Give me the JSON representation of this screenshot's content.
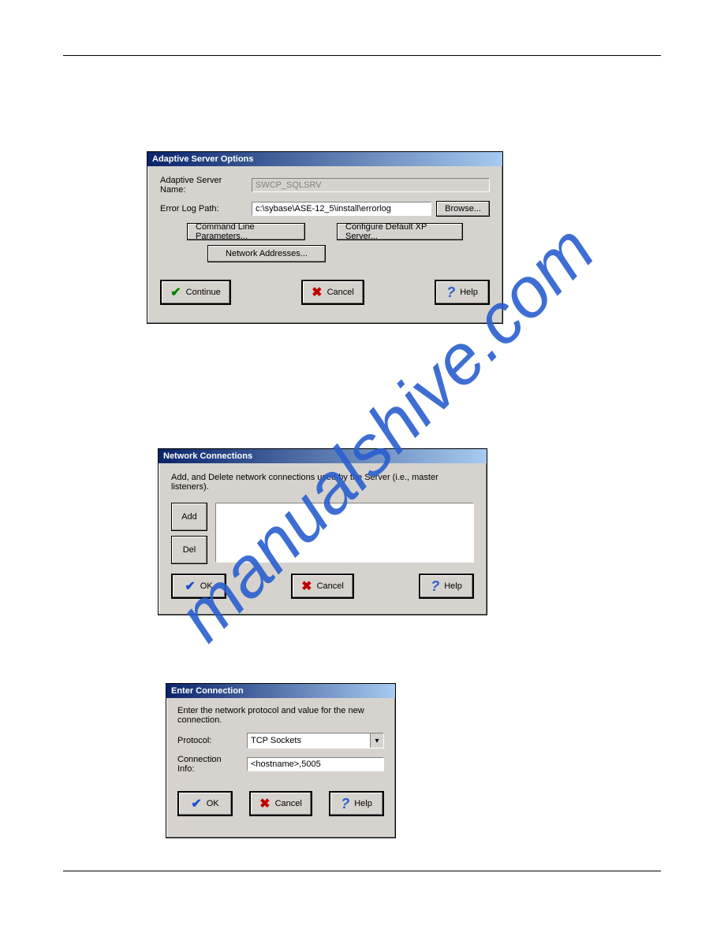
{
  "watermark": "manualshive.com",
  "dialog1": {
    "title": "Adaptive Server Options",
    "server_name_label": "Adaptive Server Name:",
    "server_name_value": "SWCP_SQLSRV",
    "error_log_label": "Error Log Path:",
    "error_log_value": "c:\\sybase\\ASE-12_5\\install\\errorlog",
    "browse_label": "Browse...",
    "cmd_params_label": "Command Line Parameters...",
    "configure_xp_label": "Configure Default XP Server...",
    "network_addr_label": "Network Addresses...",
    "continue_label": "Continue",
    "cancel_label": "Cancel",
    "help_label": "Help"
  },
  "dialog2": {
    "title": "Network Connections",
    "instructions": "Add, and Delete network connections used by the Server (i.e., master listeners).",
    "add_label": "Add",
    "del_label": "Del",
    "ok_label": "OK",
    "cancel_label": "Cancel",
    "help_label": "Help"
  },
  "dialog3": {
    "title": "Enter Connection",
    "instructions": "Enter the network protocol and value for the new connection.",
    "protocol_label": "Protocol:",
    "protocol_value": "TCP Sockets",
    "conn_info_label": "Connection Info:",
    "conn_info_value": "<hostname>,5005",
    "ok_label": "OK",
    "cancel_label": "Cancel",
    "help_label": "Help"
  }
}
